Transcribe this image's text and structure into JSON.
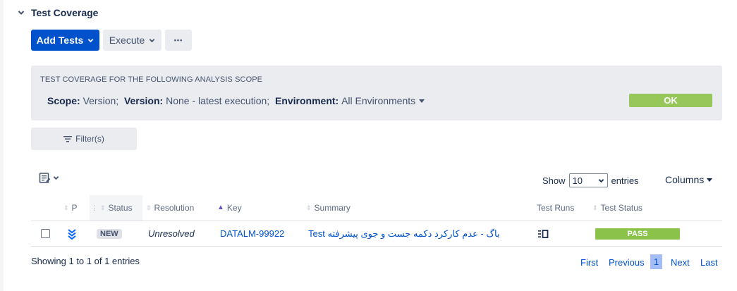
{
  "section": {
    "title": "Test Coverage"
  },
  "toolbar": {
    "add_tests_label": "Add Tests",
    "execute_label": "Execute",
    "more_label": "•••"
  },
  "scope": {
    "heading": "TEST COVERAGE FOR THE FOLLOWING ANALYSIS SCOPE",
    "scope_label": "Scope:",
    "scope_value": "Version;",
    "version_label": "Version:",
    "version_value": "None - latest execution;",
    "environment_label": "Environment:",
    "environment_value": "All Environments",
    "ok_label": "OK"
  },
  "filter": {
    "label": "Filter(s)"
  },
  "controls": {
    "show_label": "Show",
    "show_value": "10",
    "entries_label": "entries",
    "columns_label": "Columns"
  },
  "table": {
    "headers": {
      "priority": "P",
      "status": "Status",
      "resolution": "Resolution",
      "key": "Key",
      "summary": "Summary",
      "test_runs": "Test Runs",
      "test_status": "Test Status"
    },
    "rows": [
      {
        "status": "NEW",
        "resolution": "Unresolved",
        "key": "DATALM-99922",
        "summary": "Test باگ - عدم کارکرد دکمه جست و جوی پیشرفته",
        "test_status": "PASS"
      }
    ]
  },
  "footer": {
    "info": "Showing 1 to 1 of 1 entries",
    "first": "First",
    "previous": "Previous",
    "current_page": "1",
    "next": "Next",
    "last": "Last"
  },
  "colors": {
    "primary": "#0052cc",
    "pass": "#8bc34a",
    "ok": "#97c65a",
    "panel": "#ebecf0"
  }
}
